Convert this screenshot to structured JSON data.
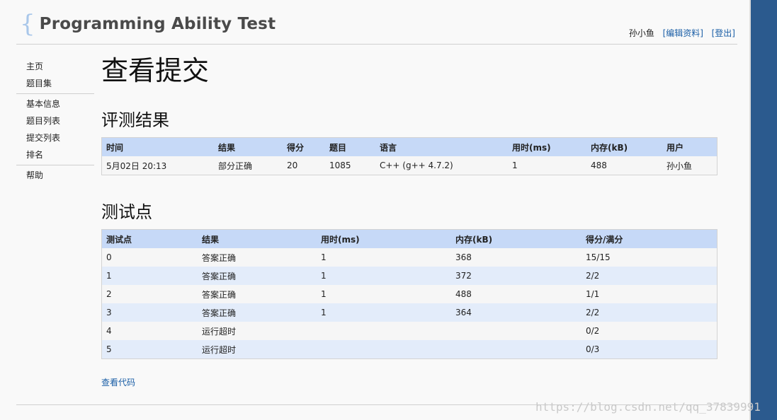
{
  "header": {
    "brace": "{",
    "title": "Programming Ability Test",
    "user": "孙小鱼",
    "edit_profile": "[编辑资料]",
    "logout": "[登出]"
  },
  "sidebar": {
    "groups": [
      {
        "items": [
          "主页",
          "题目集"
        ]
      },
      {
        "items": [
          "基本信息",
          "题目列表",
          "提交列表",
          "排名"
        ]
      },
      {
        "items": [
          "帮助"
        ]
      }
    ]
  },
  "main": {
    "title": "查看提交",
    "result_section": "评测结果",
    "result_headers": [
      "时间",
      "结果",
      "得分",
      "题目",
      "语言",
      "用时(ms)",
      "内存(kB)",
      "用户"
    ],
    "result_row": {
      "time": "5月02日 20:13",
      "status": "部分正确",
      "score": "20",
      "problem": "1085",
      "language": "C++ (g++ 4.7.2)",
      "time_ms": "1",
      "memory": "488",
      "user": "孙小鱼"
    },
    "tests_section": "测试点",
    "tests_headers": [
      "测试点",
      "结果",
      "用时(ms)",
      "内存(kB)",
      "得分/满分"
    ],
    "tests": [
      {
        "id": "0",
        "result": "答案正确",
        "time": "1",
        "memory": "368",
        "score": "15/15",
        "kind": "ac"
      },
      {
        "id": "1",
        "result": "答案正确",
        "time": "1",
        "memory": "372",
        "score": "2/2",
        "kind": "ac"
      },
      {
        "id": "2",
        "result": "答案正确",
        "time": "1",
        "memory": "488",
        "score": "1/1",
        "kind": "ac"
      },
      {
        "id": "3",
        "result": "答案正确",
        "time": "1",
        "memory": "364",
        "score": "2/2",
        "kind": "ac"
      },
      {
        "id": "4",
        "result": "运行超时",
        "time": "",
        "memory": "",
        "score": "0/2",
        "kind": "tle"
      },
      {
        "id": "5",
        "result": "运行超时",
        "time": "",
        "memory": "",
        "score": "0/3",
        "kind": "tle"
      }
    ],
    "view_code": "查看代码"
  },
  "watermark": "https://blog.csdn.net/qq_37839991",
  "colors": {
    "accent_blue": "#1a5ea6",
    "header_row": "#c6d9f7",
    "accepted": "#d01515",
    "partial_tle": "#1b8a1b",
    "side_stripe": "#2b5a8e"
  }
}
